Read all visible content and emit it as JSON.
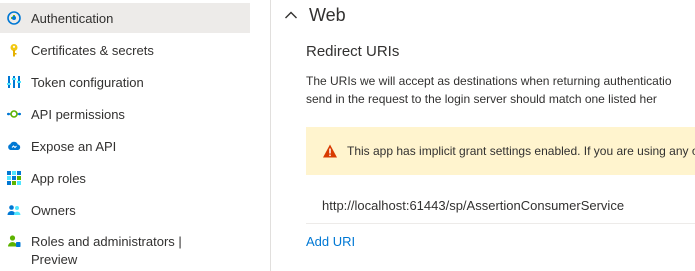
{
  "sidebar": {
    "items": [
      {
        "label": "Authentication",
        "icon": "authentication-icon",
        "active": true
      },
      {
        "label": "Certificates & secrets",
        "icon": "key-icon"
      },
      {
        "label": "Token configuration",
        "icon": "token-configuration-icon"
      },
      {
        "label": "API permissions",
        "icon": "api-permissions-icon"
      },
      {
        "label": "Expose an API",
        "icon": "cloud-icon"
      },
      {
        "label": "App roles",
        "icon": "app-roles-grid-icon"
      },
      {
        "label": "Owners",
        "icon": "owners-icon"
      },
      {
        "label": "Roles and administrators | Preview",
        "icon": "roles-administrators-icon"
      }
    ]
  },
  "main": {
    "section_title": "Web",
    "subheading": "Redirect URIs",
    "description_line1": "The URIs we will accept as destinations when returning authenticatio",
    "description_line2": "send in the request to the login server should match one listed her",
    "warning_text": "This app has implicit grant settings enabled. If you are using any o",
    "redirect_uri": "http://localhost:61443/sp/AssertionConsumerService",
    "add_uri_label": "Add URI"
  },
  "colors": {
    "accent": "#0078d4",
    "active_nav_bg": "#edebe9",
    "warning_bg": "#fff4ce",
    "warning_icon": "#d83b01"
  }
}
